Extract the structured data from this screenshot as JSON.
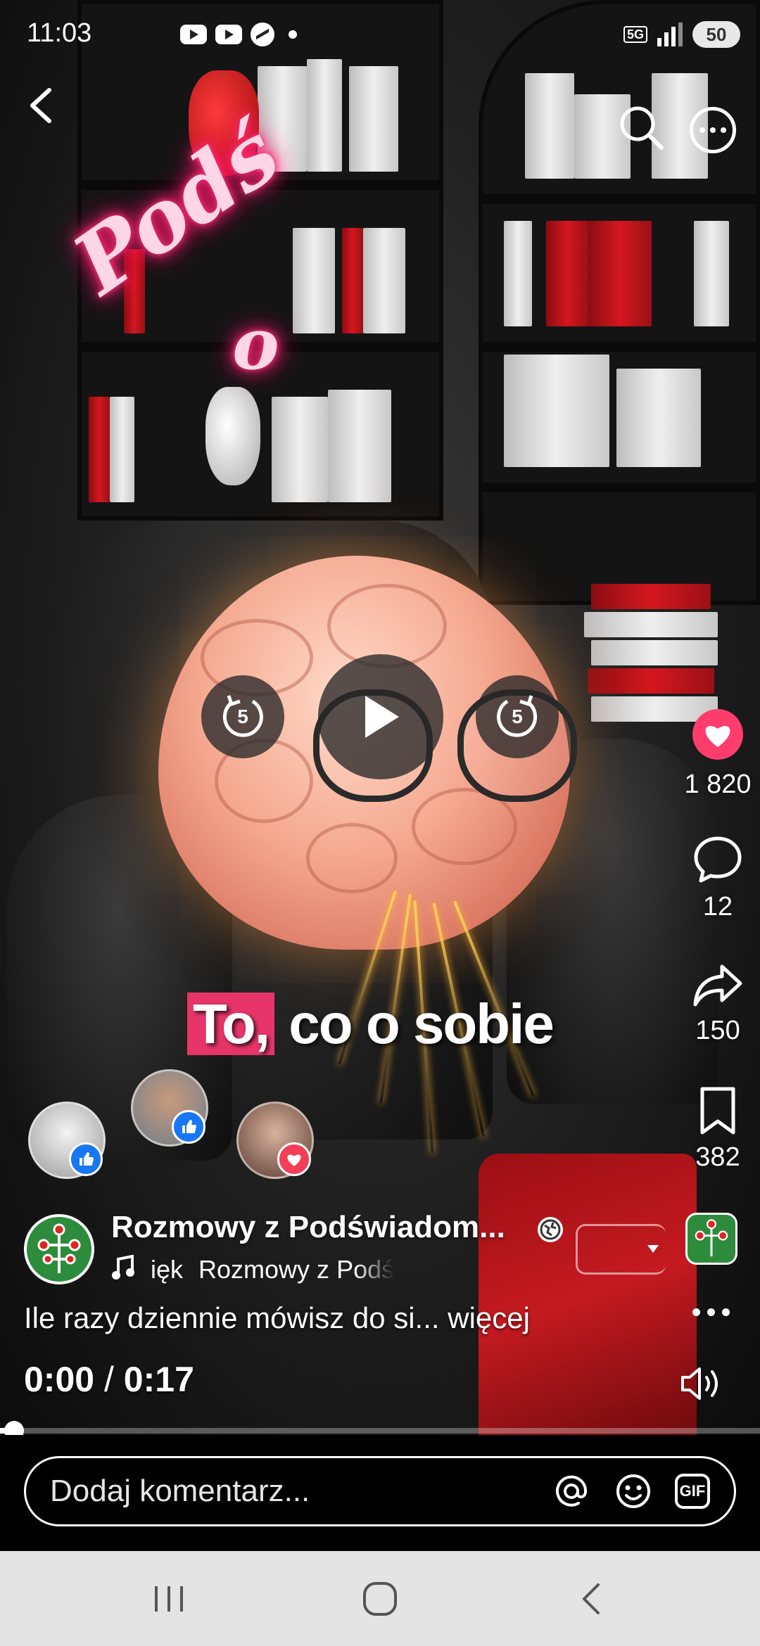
{
  "status_bar": {
    "time": "11:03",
    "network": "5G",
    "battery": "50"
  },
  "video": {
    "neon_text_line1": "Podś",
    "neon_text_line2": "o",
    "subtitle_highlight": "To,",
    "subtitle_rest": " co o sobie",
    "accent_color": "#e7356a"
  },
  "actions": {
    "like_count": "1 820",
    "comment_count": "12",
    "share_count": "150",
    "save_count": "382"
  },
  "controls": {
    "rewind_seconds": "5",
    "forward_seconds": "5"
  },
  "post": {
    "page_name": "Rozmowy z Podświadom...",
    "audio_label": "ięk",
    "audio_source": "Rozmowy z Podś",
    "caption": "Ile razy dziennie mówisz do si...",
    "more_label": "więcej",
    "current_time": "0:00",
    "separator": "/",
    "duration": "0:17",
    "progress_fraction": 0.02
  },
  "comment": {
    "placeholder": "Dodaj komentarz...",
    "gif_label": "GIF"
  },
  "icons": {
    "back": "back-arrow-icon",
    "search": "search-icon",
    "more": "more-options-icon",
    "like": "heart-icon",
    "comment": "comment-icon",
    "share": "share-icon",
    "save": "bookmark-icon",
    "volume": "volume-icon",
    "mention": "at-icon",
    "emoji": "emoji-icon"
  }
}
